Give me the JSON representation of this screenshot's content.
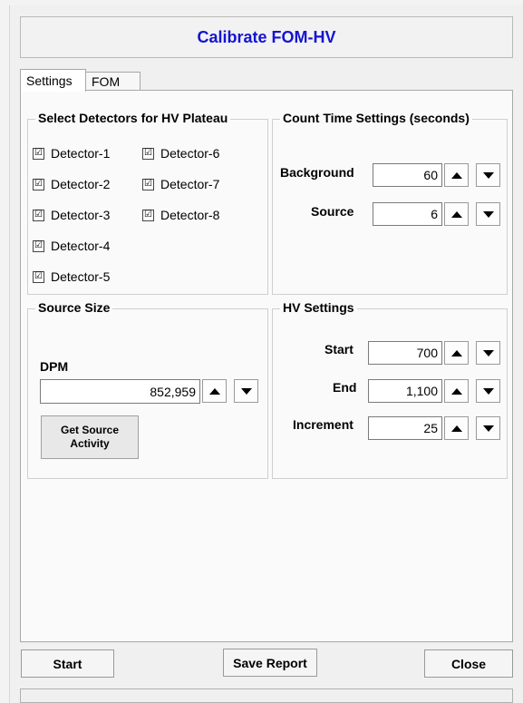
{
  "window": {
    "title": "Calibrate FOM-HV"
  },
  "tabs": [
    {
      "label": "Settings",
      "active": true
    },
    {
      "label": "FOM",
      "active": false
    }
  ],
  "detectors": {
    "title": "Select Detectors for HV Plateau",
    "items": [
      {
        "label": "Detector-1",
        "checked": true
      },
      {
        "label": "Detector-2",
        "checked": true
      },
      {
        "label": "Detector-3",
        "checked": true
      },
      {
        "label": "Detector-4",
        "checked": true
      },
      {
        "label": "Detector-5",
        "checked": true
      },
      {
        "label": "Detector-6",
        "checked": true
      },
      {
        "label": "Detector-7",
        "checked": true
      },
      {
        "label": "Detector-8",
        "checked": true
      }
    ],
    "check_glyph": "☑"
  },
  "count_time": {
    "title": "Count Time Settings (seconds)",
    "background_label": "Background",
    "background_value": "60",
    "source_label": "Source",
    "source_value": "6"
  },
  "source_size": {
    "title": "Source Size",
    "dpm_label": "DPM",
    "dpm_value": "852,959",
    "get_activity_line1": "Get Source",
    "get_activity_line2": "Activity"
  },
  "hv_settings": {
    "title": "HV Settings",
    "start_label": "Start",
    "start_value": "700",
    "end_label": "End",
    "end_value": "1,100",
    "increment_label": "Increment",
    "increment_value": "25"
  },
  "footer": {
    "start_label": "Start",
    "save_report_label": "Save Report",
    "close_label": "Close"
  },
  "colors": {
    "title": "#1414d2",
    "panel": "#fafafa",
    "window": "#f0f0f0"
  }
}
